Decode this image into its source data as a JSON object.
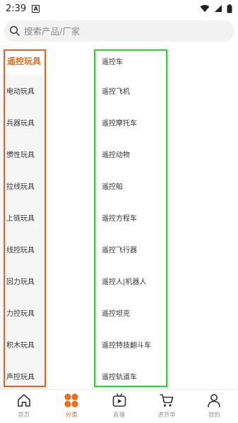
{
  "status": {
    "time": "2:39",
    "notification_glyph": "A"
  },
  "search": {
    "placeholder": "搜索产品/厂家"
  },
  "sidebar": {
    "items": [
      {
        "label": "遥控玩具",
        "active": true
      },
      {
        "label": "电动玩具"
      },
      {
        "label": "兵器玩具"
      },
      {
        "label": "惯性玩具"
      },
      {
        "label": "拉线玩具"
      },
      {
        "label": "上链玩具"
      },
      {
        "label": "线控玩具"
      },
      {
        "label": "回力玩具"
      },
      {
        "label": "力控玩具"
      },
      {
        "label": "积木玩具"
      },
      {
        "label": "声控玩具"
      }
    ]
  },
  "categories": {
    "items": [
      {
        "label": "遥控车"
      },
      {
        "label": "遥控飞机"
      },
      {
        "label": "遥控摩托车"
      },
      {
        "label": "遥控动物"
      },
      {
        "label": "遥控船"
      },
      {
        "label": "遥控方程车"
      },
      {
        "label": "遥控飞行器"
      },
      {
        "label": "遥控人|机器人"
      },
      {
        "label": "遥控坦克"
      },
      {
        "label": "遥控特技翻斗车"
      },
      {
        "label": "遥控轨道车"
      }
    ]
  },
  "bottom_nav": {
    "items": [
      {
        "label": "首页",
        "icon": "home-icon"
      },
      {
        "label": "分类",
        "icon": "category-icon",
        "active": true
      },
      {
        "label": "直播",
        "icon": "live-tv-icon"
      },
      {
        "label": "进货单",
        "icon": "cart-icon"
      },
      {
        "label": "我的",
        "icon": "person-icon"
      }
    ]
  },
  "colors": {
    "accent": "#ee6d1b",
    "highlight_left": "#e0641e",
    "highlight_right": "#22dd22"
  }
}
